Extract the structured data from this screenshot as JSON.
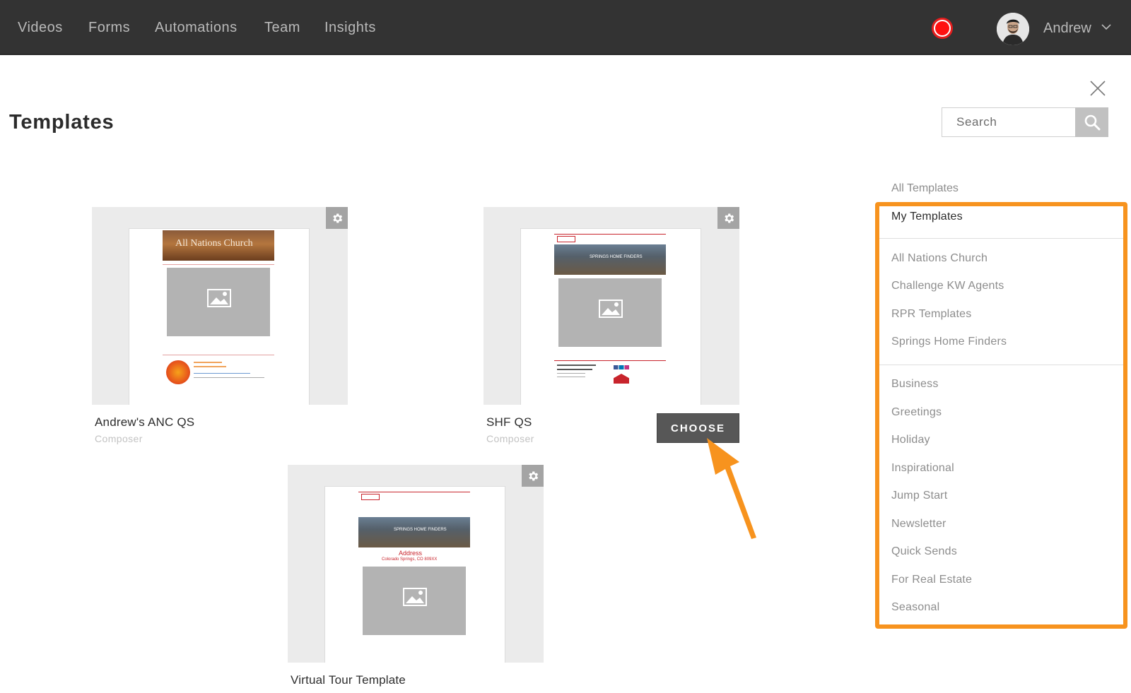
{
  "nav": {
    "items": [
      "Videos",
      "Forms",
      "Automations",
      "Team",
      "Insights"
    ],
    "user_name": "Andrew"
  },
  "page": {
    "title": "Templates",
    "search_placeholder": "Search"
  },
  "cards": [
    {
      "name": "Andrew's ANC QS",
      "sub": "Composer",
      "preview_title": "All Nations Church"
    },
    {
      "name": "SHF QS",
      "sub": "Composer",
      "choose_label": "CHOOSE",
      "preview_title": "SPRINGS HOME FINDERS"
    },
    {
      "name": "Virtual Tour Template",
      "sub": "",
      "preview_title": "SPRINGS HOME FINDERS",
      "preview_address": "Address",
      "preview_city": "Colorado Springs, CO 809XX"
    }
  ],
  "sidebar": {
    "all_label": "All Templates",
    "my_label": "My Templates",
    "groups": [
      "All Nations Church",
      "Challenge KW Agents",
      "RPR Templates",
      "Springs Home Finders"
    ],
    "categories": [
      "Business",
      "Greetings",
      "Holiday",
      "Inspirational",
      "Jump Start",
      "Newsletter",
      "Quick Sends",
      "For Real Estate",
      "Seasonal"
    ]
  },
  "colors": {
    "nav_bg": "#333333",
    "highlight": "#f7931e",
    "record": "#ff1010",
    "choose_bg": "#575757"
  },
  "icons": [
    "record-icon",
    "avatar",
    "chevron-down-icon",
    "close-icon",
    "search-icon",
    "gear-icon",
    "image-placeholder-icon",
    "arrow-annotation"
  ]
}
